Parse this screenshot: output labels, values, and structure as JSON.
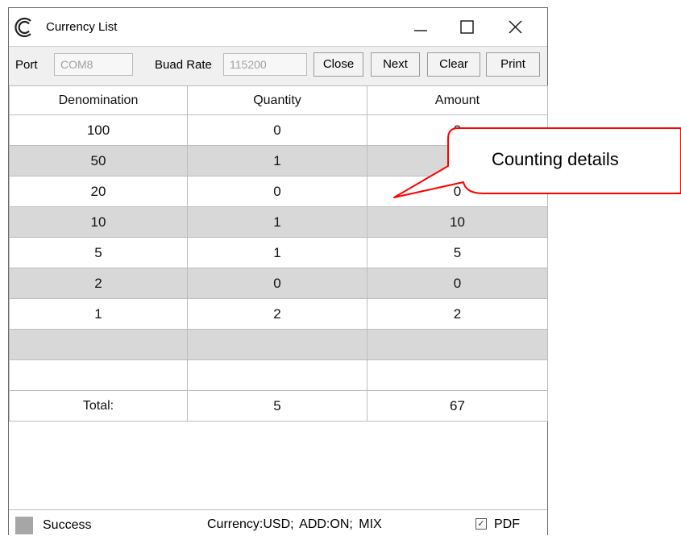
{
  "window": {
    "title": "Currency List",
    "controls": [
      "minimize-icon",
      "maximize-icon",
      "close-icon"
    ]
  },
  "toolbar": {
    "port_label": "Port",
    "port_value": "COM8",
    "baud_label": "Buad Rate",
    "baud_value": "115200",
    "close_label": "Close",
    "next_label": "Next",
    "clear_label": "Clear",
    "print_label": "Print"
  },
  "table": {
    "headers": [
      "Denomination",
      "Quantity",
      "Amount"
    ],
    "rows": [
      [
        "100",
        "0",
        "0"
      ],
      [
        "50",
        "1",
        ""
      ],
      [
        "20",
        "0",
        "0"
      ],
      [
        "10",
        "1",
        "10"
      ],
      [
        "5",
        "1",
        "5"
      ],
      [
        "2",
        "0",
        "0"
      ],
      [
        "1",
        "2",
        "2"
      ],
      [
        "",
        "",
        ""
      ],
      [
        "",
        "",
        ""
      ]
    ],
    "total": {
      "label": "Total:",
      "quantity": "5",
      "amount": "67"
    }
  },
  "status": {
    "text": "Success",
    "info": "Currency:USD;  ADD:ON;  MIX",
    "pdf_label": "PDF",
    "pdf_checked": true,
    "swatch_color": "#a6a6a6"
  },
  "annotation": {
    "text": "Counting details",
    "color": "#ff0000"
  }
}
